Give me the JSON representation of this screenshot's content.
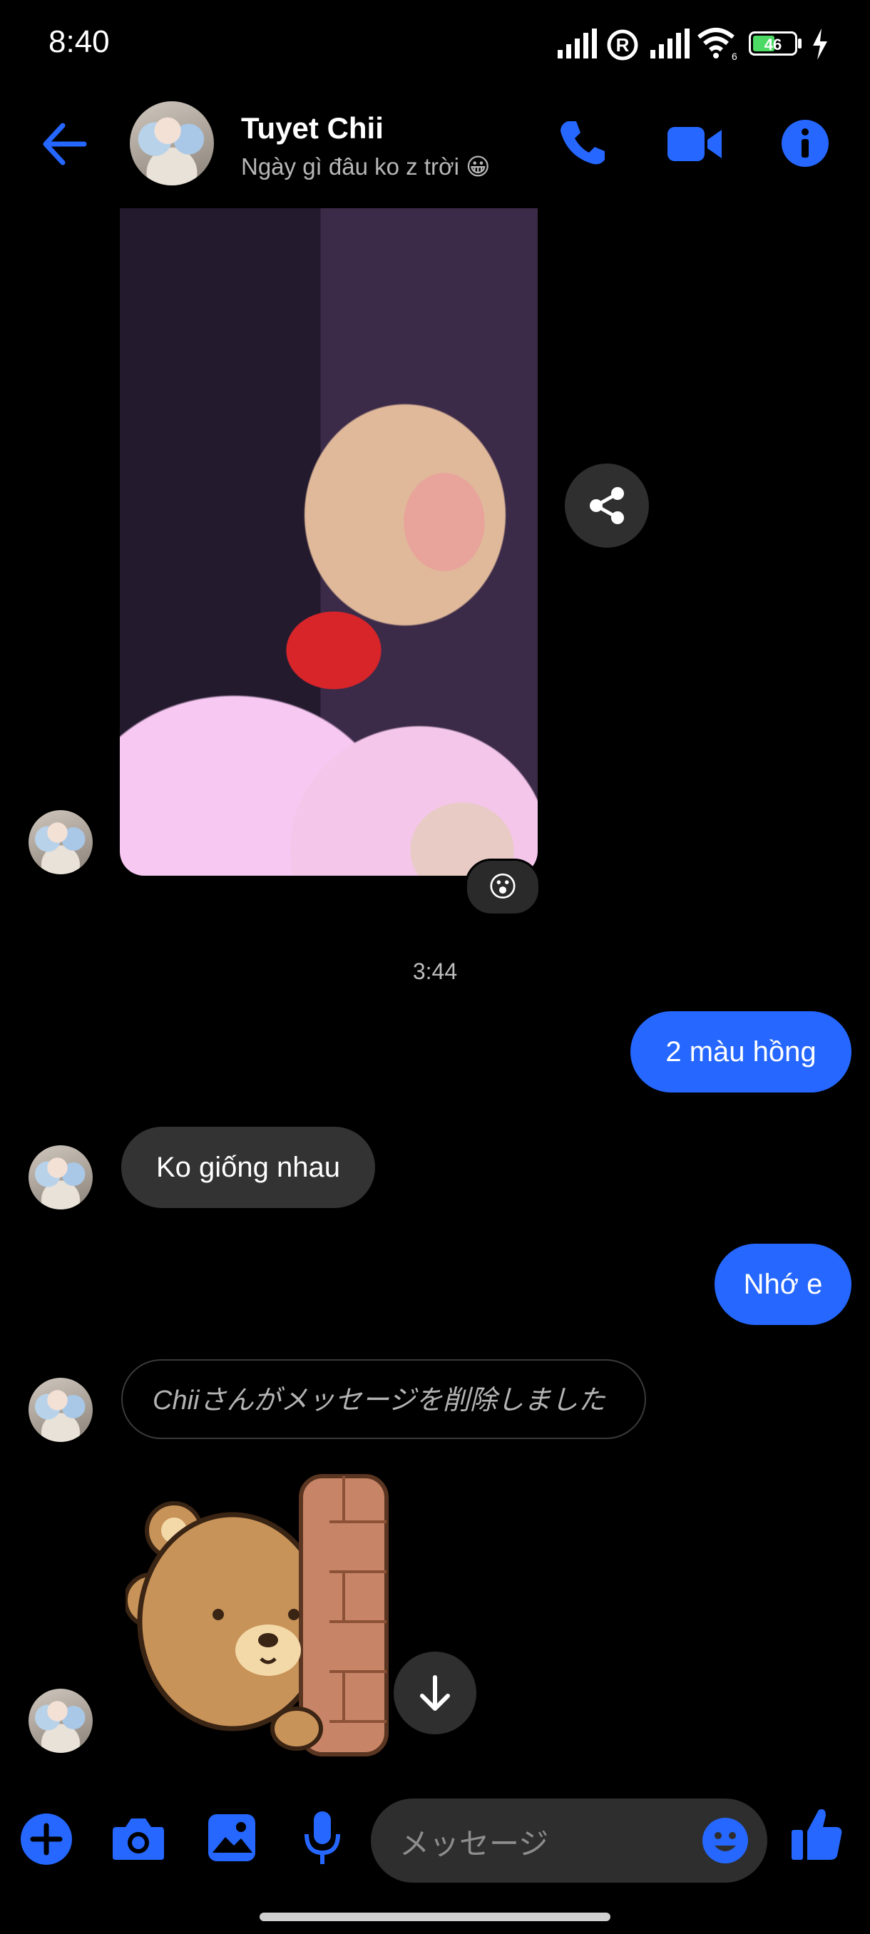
{
  "status_bar": {
    "time": "8:40",
    "battery": "46"
  },
  "header": {
    "name": "Tuyet Chii",
    "status": "Ngày gì đâu ko z trời 😀",
    "icons": [
      "back-arrow-icon",
      "phone-icon",
      "video-camera-icon",
      "info-icon"
    ]
  },
  "messages": {
    "photo_reaction": "😮",
    "time_separator": "3:44",
    "out_1": "2 màu hồng",
    "in_1": "Ko giống nhau",
    "out_2": "Nhớ e",
    "deleted_notice": "Chiiさんがメッセージを削除しました"
  },
  "composer": {
    "placeholder": "メッセージ",
    "icons": [
      "plus-icon",
      "camera-icon",
      "gallery-icon",
      "microphone-icon",
      "emoji-icon",
      "thumbs-up-icon"
    ]
  },
  "colors": {
    "accent": "#2567ff",
    "incoming_bubble": "#333333",
    "background": "#000000"
  }
}
